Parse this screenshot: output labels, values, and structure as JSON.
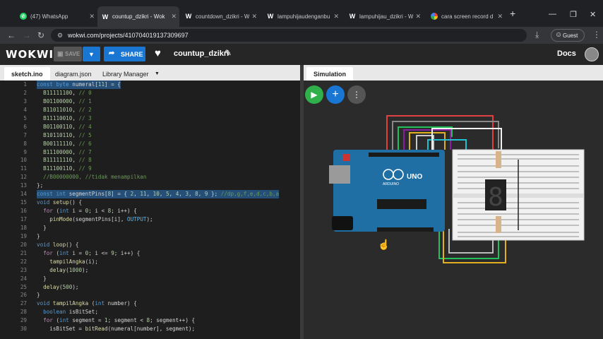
{
  "browser": {
    "tabs": [
      {
        "label": "(47) WhatsApp",
        "icon": "whatsapp-icon"
      },
      {
        "label": "countup_dzikri - Wok",
        "icon": "wokwi-icon"
      },
      {
        "label": "countdown_dzikri - W",
        "icon": "wokwi-icon"
      },
      {
        "label": "lampuhijaudenganbu",
        "icon": "wokwi-icon"
      },
      {
        "label": "lampuhijau_dzikri - W",
        "icon": "wokwi-icon"
      },
      {
        "label": "cara screen record d",
        "icon": "google-icon"
      }
    ],
    "new_tab": "+",
    "url": "wokwi.com/projects/410704019137309697",
    "profile_label": "Guest"
  },
  "wokwi": {
    "logo": "WOKWI",
    "save_label": "SAVE",
    "share_label": "SHARE",
    "project_name": "countup_dzikri",
    "docs_label": "Docs"
  },
  "editor": {
    "tabs": [
      "sketch.ino",
      "diagram.json",
      "Library Manager"
    ],
    "line_numbers": [
      "1",
      "2",
      "3",
      "4",
      "5",
      "6",
      "7",
      "8",
      "9",
      "10",
      "11",
      "12",
      "13",
      "14",
      "15",
      "16",
      "17",
      "18",
      "19",
      "20",
      "21",
      "22",
      "23",
      "24",
      "25",
      "26",
      "27",
      "28",
      "29",
      "30"
    ]
  },
  "simulation": {
    "tab_label": "Simulation",
    "board_label": "UNO",
    "board_brand": "ARDUINO",
    "display_digit": "8"
  },
  "colors": {
    "accent": "#1976d2",
    "run": "#2fb04a",
    "arduino": "#1f6fa5"
  }
}
